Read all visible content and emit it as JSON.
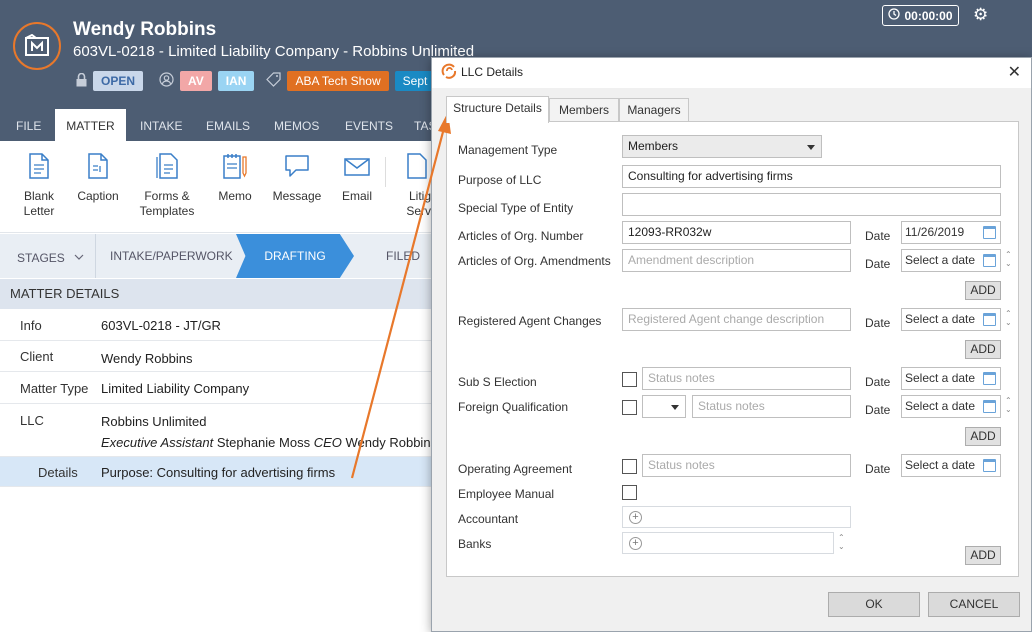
{
  "header": {
    "client_name": "Wendy Robbins",
    "matter_line": "603VL-0218  -  Limited Liability Company  -  Robbins Unlimited",
    "tags": [
      "OPEN",
      "AV",
      "IAN",
      "ABA Tech Show",
      "Sept"
    ],
    "timer": "00:00:00"
  },
  "menu": {
    "tabs": [
      "FILE",
      "MATTER",
      "INTAKE",
      "EMAILS",
      "MEMOS",
      "EVENTS",
      "TAS"
    ],
    "active": "MATTER"
  },
  "ribbon": {
    "buttons": [
      {
        "line1": "Blank",
        "line2": "Letter"
      },
      {
        "line1": "Caption",
        "line2": ""
      },
      {
        "line1": "Forms &",
        "line2": "Templates"
      },
      {
        "line1": "Memo",
        "line2": ""
      },
      {
        "line1": "Message",
        "line2": ""
      },
      {
        "line1": "Email",
        "line2": ""
      },
      {
        "line1": "Litig",
        "line2": "Servi"
      }
    ]
  },
  "stages": {
    "label": "STAGES",
    "items": [
      "INTAKE/PAPERWORK",
      "DRAFTING",
      "FILED"
    ]
  },
  "matter_details": {
    "title": "MATTER DETAILS",
    "rows": [
      {
        "label": "Info",
        "value": "603VL-0218 - JT/GR"
      },
      {
        "label": "Client",
        "value": "Wendy Robbins"
      },
      {
        "label": "Matter Type",
        "value": "Limited Liability Company"
      },
      {
        "label": "LLC",
        "value": "Robbins Unlimited",
        "title1": "Executive Assistant",
        "name1": "Stephanie Moss",
        "title2": "CEO",
        "name2": "Wendy Robbins"
      },
      {
        "label": "Details",
        "value": "Purpose: Consulting for advertising firms"
      }
    ]
  },
  "dialog": {
    "title": "LLC Details",
    "tabs": [
      "Structure Details",
      "Members",
      "Managers"
    ],
    "fields": {
      "management_type_label": "Management Type",
      "management_type_value": "Members",
      "purpose_label": "Purpose of LLC",
      "purpose_value": "Consulting for advertising firms",
      "special_type_label": "Special Type of Entity",
      "special_type_value": "",
      "org_number_label": "Articles of Org. Number",
      "org_number_value": "12093-RR032w",
      "org_number_date": "11/26/2019",
      "amendments_label": "Articles of Org. Amendments",
      "amendments_placeholder": "Amendment description",
      "agent_label": "Registered Agent Changes",
      "agent_placeholder": "Registered Agent change description",
      "subs_label": "Sub S Election",
      "foreign_label": "Foreign Qualification",
      "operating_label": "Operating Agreement",
      "employee_label": "Employee Manual",
      "accountant_label": "Accountant",
      "banks_label": "Banks",
      "status_placeholder": "Status notes",
      "date_label": "Date",
      "date_placeholder": "Select a date",
      "add_label": "ADD"
    },
    "ok_label": "OK",
    "cancel_label": "CANCEL"
  },
  "colors": {
    "header_bg": "#4d5d73",
    "accent_orange": "#e8782b",
    "drafting_blue": "#3b8fdb",
    "selected_row": "#d7e7f7"
  }
}
